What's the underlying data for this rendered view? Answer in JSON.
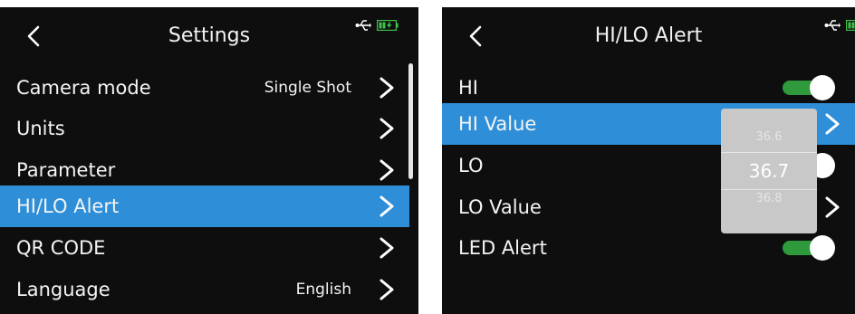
{
  "left": {
    "title": "Settings",
    "items": [
      {
        "label": "Camera mode",
        "value": "Single Shot"
      },
      {
        "label": "Units",
        "value": ""
      },
      {
        "label": "Parameter",
        "value": ""
      },
      {
        "label": "HI/LO Alert",
        "value": ""
      },
      {
        "label": "QR CODE",
        "value": ""
      },
      {
        "label": "Language",
        "value": "English"
      }
    ],
    "selected_index": 3
  },
  "right": {
    "title": "HI/LO Alert",
    "items": [
      {
        "label": "HI",
        "control": "toggle",
        "state": "on"
      },
      {
        "label": "HI Value",
        "control": "chevron"
      },
      {
        "label": "LO",
        "control": "toggle",
        "state": "on"
      },
      {
        "label": "LO Value",
        "control": "chevron"
      },
      {
        "label": "LED Alert",
        "control": "toggle",
        "state": "on"
      }
    ],
    "selected_index": 1,
    "picker": {
      "previous": "36.6",
      "current": "36.7",
      "next": "36.8"
    }
  },
  "icons": {
    "back": "back-arrow-icon",
    "usb": "usb-icon",
    "battery": "battery-charging-icon",
    "chevron": "chevron-right-icon"
  },
  "colors": {
    "background": "#0e0e0e",
    "selection": "#2e8fd8",
    "toggle_on": "#2e9a3c",
    "picker": "#c8c8c8"
  }
}
